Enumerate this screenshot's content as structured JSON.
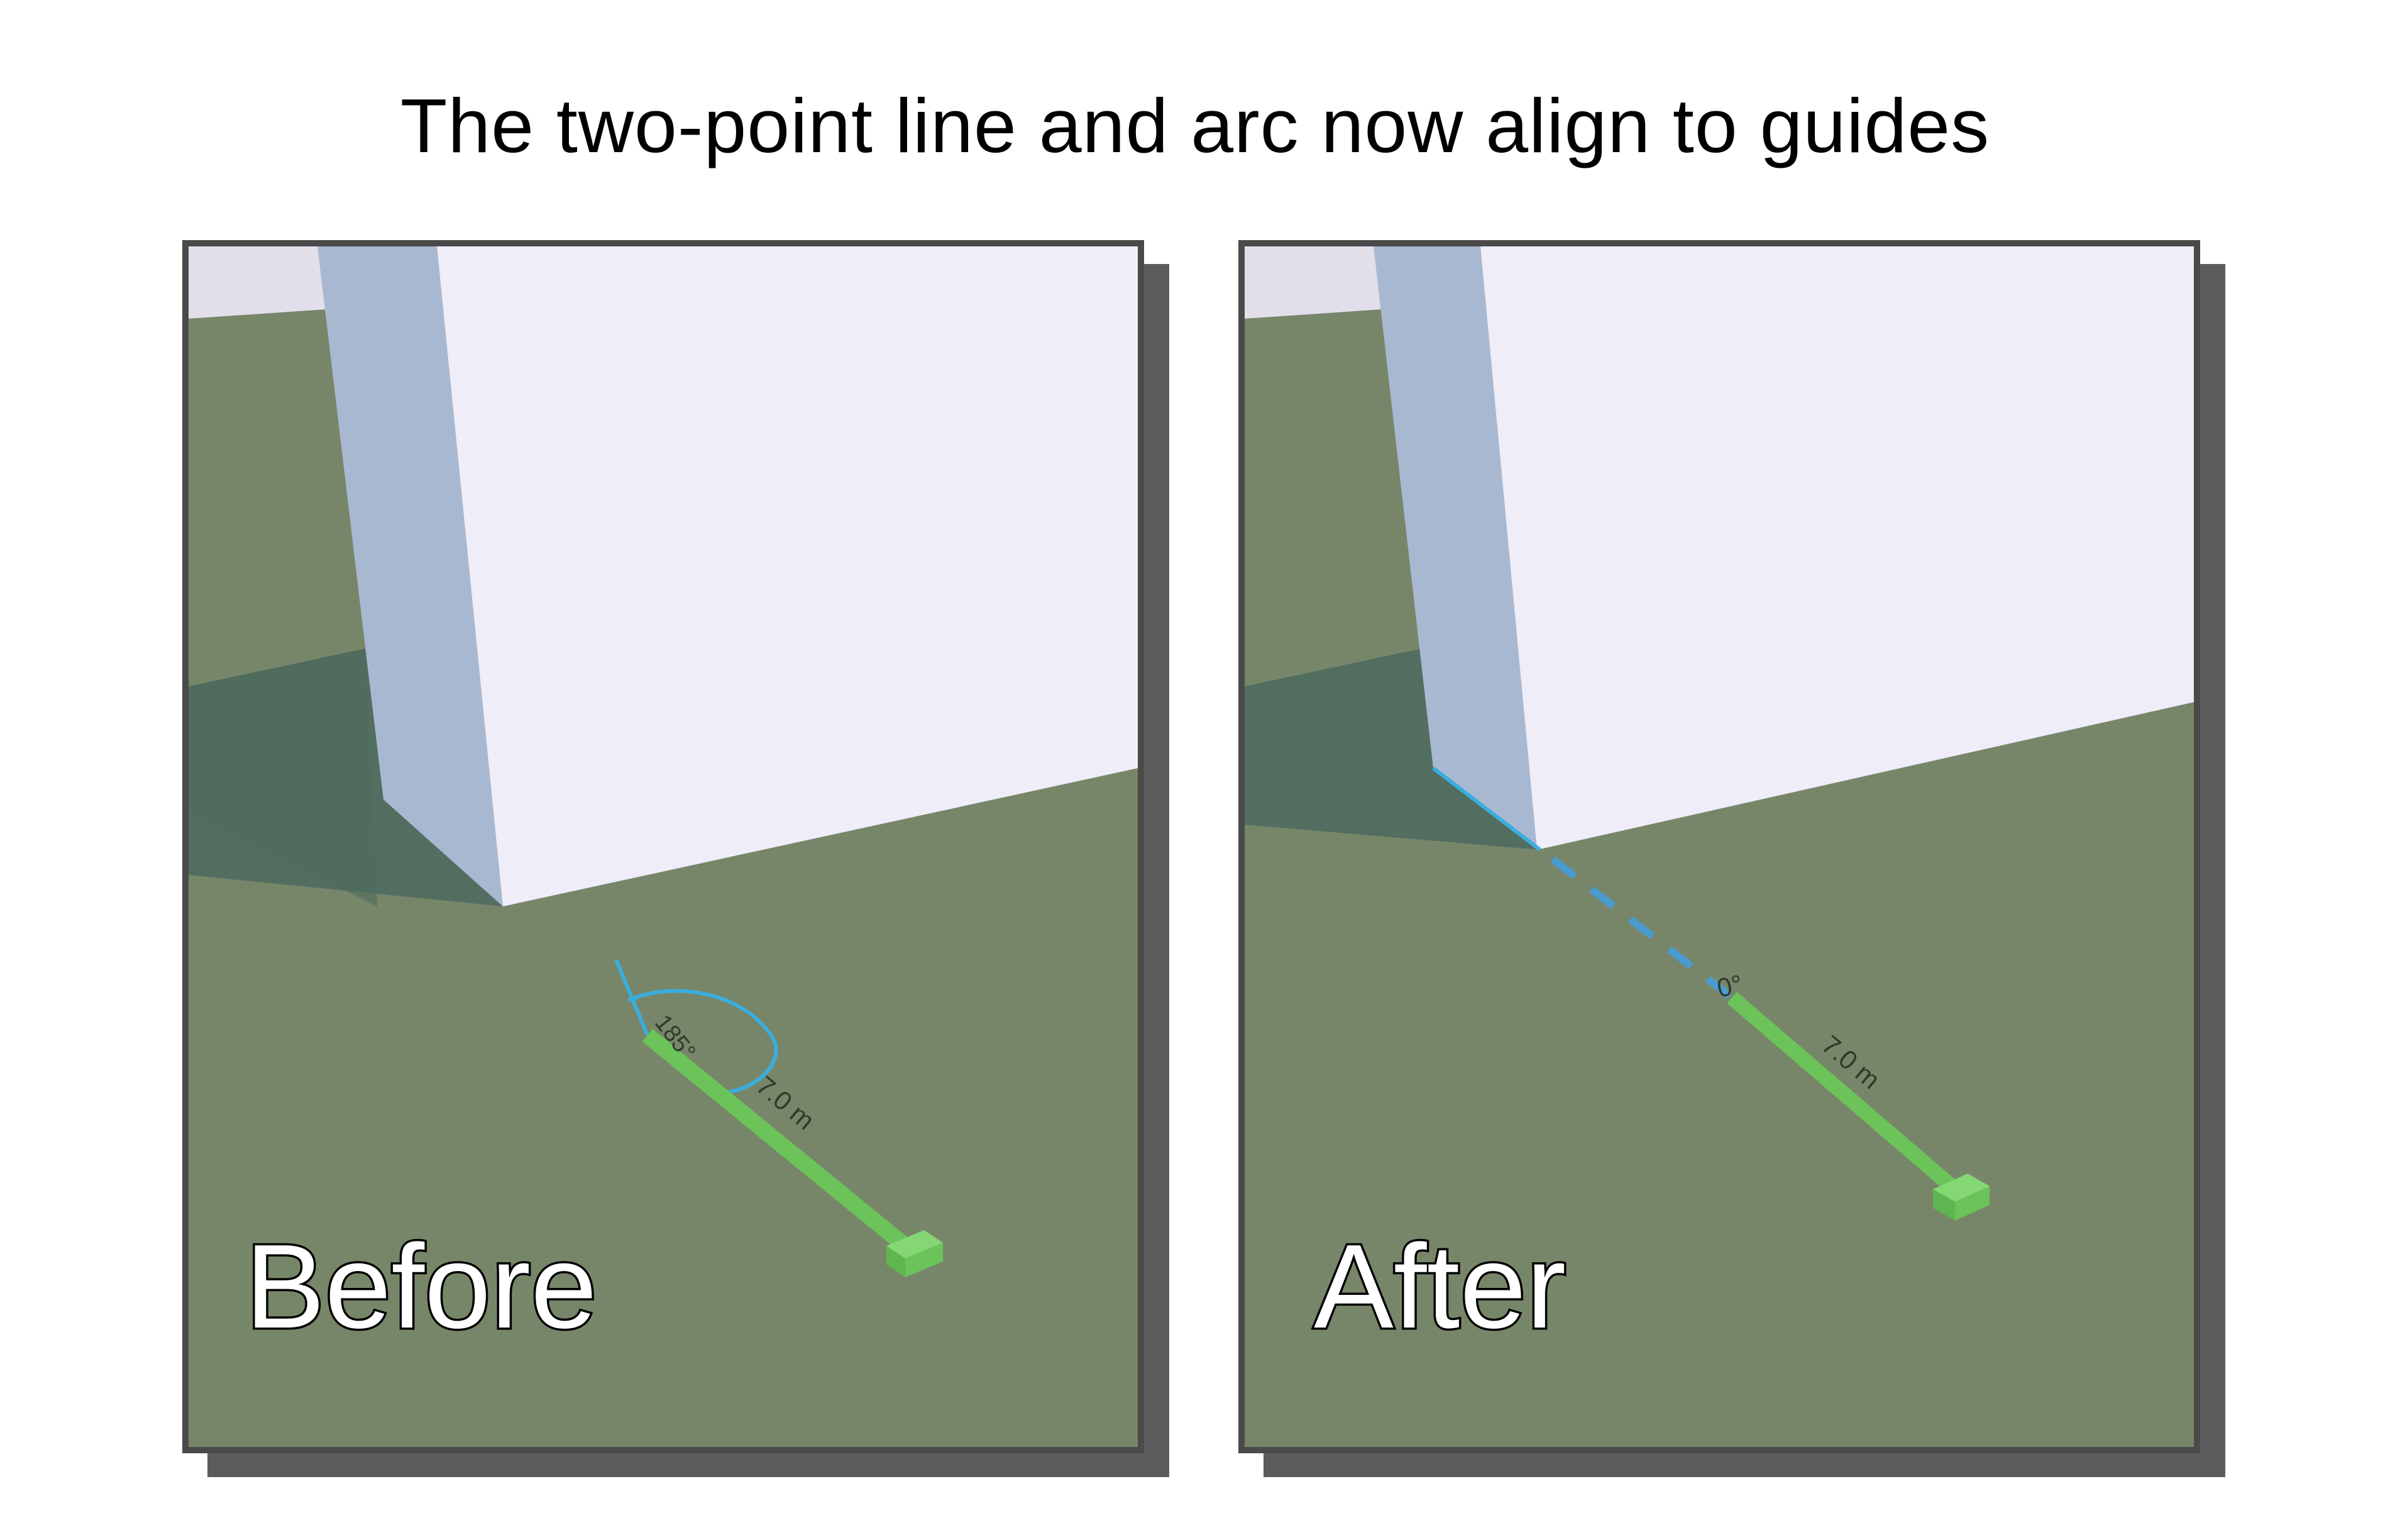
{
  "title": "The two-point line and arc now align to guides",
  "panels": [
    {
      "label": "Before",
      "angle_label": "185°",
      "length_label": "7.0 m"
    },
    {
      "label": "After",
      "angle_label": "0°",
      "length_label": "7.0 m"
    }
  ],
  "colors": {
    "ground": "#778669",
    "building_front": "#eeedf8",
    "building_side": "#a9b8d1",
    "sky": "#e2dfeb",
    "shadow": "#4e6b60",
    "line_green": "#6bc35a",
    "guide_blue": "#3aaede",
    "frame_border": "#4a4a4a",
    "frame_shadow": "#5c5c5c"
  }
}
